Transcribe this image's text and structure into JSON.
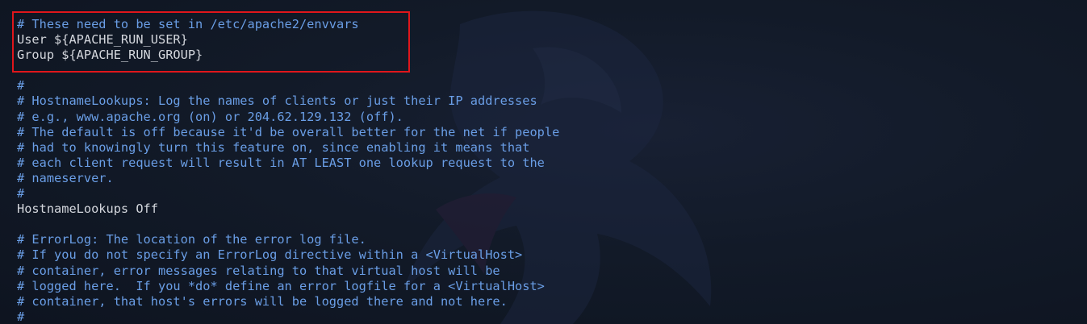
{
  "colors": {
    "background": "#121a28",
    "comment": "#6a9ee6",
    "directive": "#d4d7dd",
    "highlight_border": "#e0161b"
  },
  "background_logo": "kali-dragon-logo",
  "highlight": {
    "description_lines": [
      0,
      1,
      2
    ]
  },
  "lines": [
    {
      "type": "comment",
      "text": "# These need to be set in /etc/apache2/envvars"
    },
    {
      "type": "directive",
      "text": "User ${APACHE_RUN_USER}"
    },
    {
      "type": "directive",
      "text": "Group ${APACHE_RUN_GROUP}"
    },
    {
      "type": "blank",
      "text": ""
    },
    {
      "type": "comment",
      "text": "#"
    },
    {
      "type": "comment",
      "text": "# HostnameLookups: Log the names of clients or just their IP addresses"
    },
    {
      "type": "comment",
      "text": "# e.g., www.apache.org (on) or 204.62.129.132 (off)."
    },
    {
      "type": "comment",
      "text": "# The default is off because it'd be overall better for the net if people"
    },
    {
      "type": "comment",
      "text": "# had to knowingly turn this feature on, since enabling it means that"
    },
    {
      "type": "comment",
      "text": "# each client request will result in AT LEAST one lookup request to the"
    },
    {
      "type": "comment",
      "text": "# nameserver."
    },
    {
      "type": "comment",
      "text": "#"
    },
    {
      "type": "directive",
      "text": "HostnameLookups Off"
    },
    {
      "type": "blank",
      "text": ""
    },
    {
      "type": "comment",
      "text": "# ErrorLog: The location of the error log file."
    },
    {
      "type": "comment",
      "text": "# If you do not specify an ErrorLog directive within a <VirtualHost>"
    },
    {
      "type": "comment",
      "text": "# container, error messages relating to that virtual host will be"
    },
    {
      "type": "comment",
      "text": "# logged here.  If you *do* define an error logfile for a <VirtualHost>"
    },
    {
      "type": "comment",
      "text": "# container, that host's errors will be logged there and not here."
    },
    {
      "type": "comment",
      "text": "#"
    }
  ]
}
